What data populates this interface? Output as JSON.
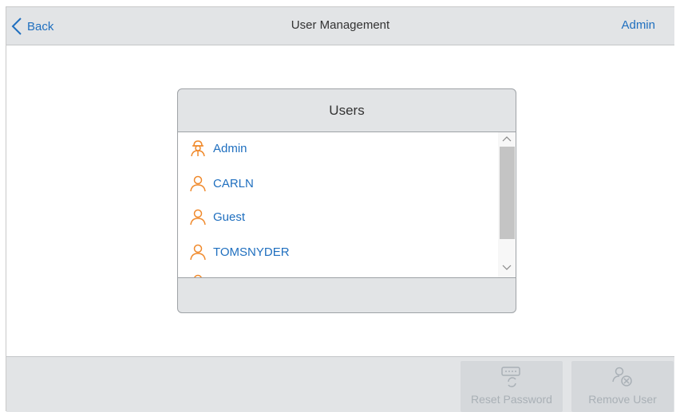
{
  "header": {
    "back_label": "Back",
    "title": "User Management",
    "current_user": "Admin"
  },
  "users_panel": {
    "title": "Users",
    "users": [
      {
        "name": "Admin",
        "icon": "admin-user-icon"
      },
      {
        "name": "CARLN",
        "icon": "user-icon"
      },
      {
        "name": "Guest",
        "icon": "user-icon"
      },
      {
        "name": "TOMSNYDER",
        "icon": "user-icon"
      }
    ]
  },
  "footer": {
    "reset_password_label": "Reset Password",
    "remove_user_label": "Remove User"
  },
  "colors": {
    "accent": "#1f6fbf",
    "user_icon": "#f08a2c",
    "header_bg": "#e2e4e6",
    "disabled_text": "#a9b0b6"
  }
}
